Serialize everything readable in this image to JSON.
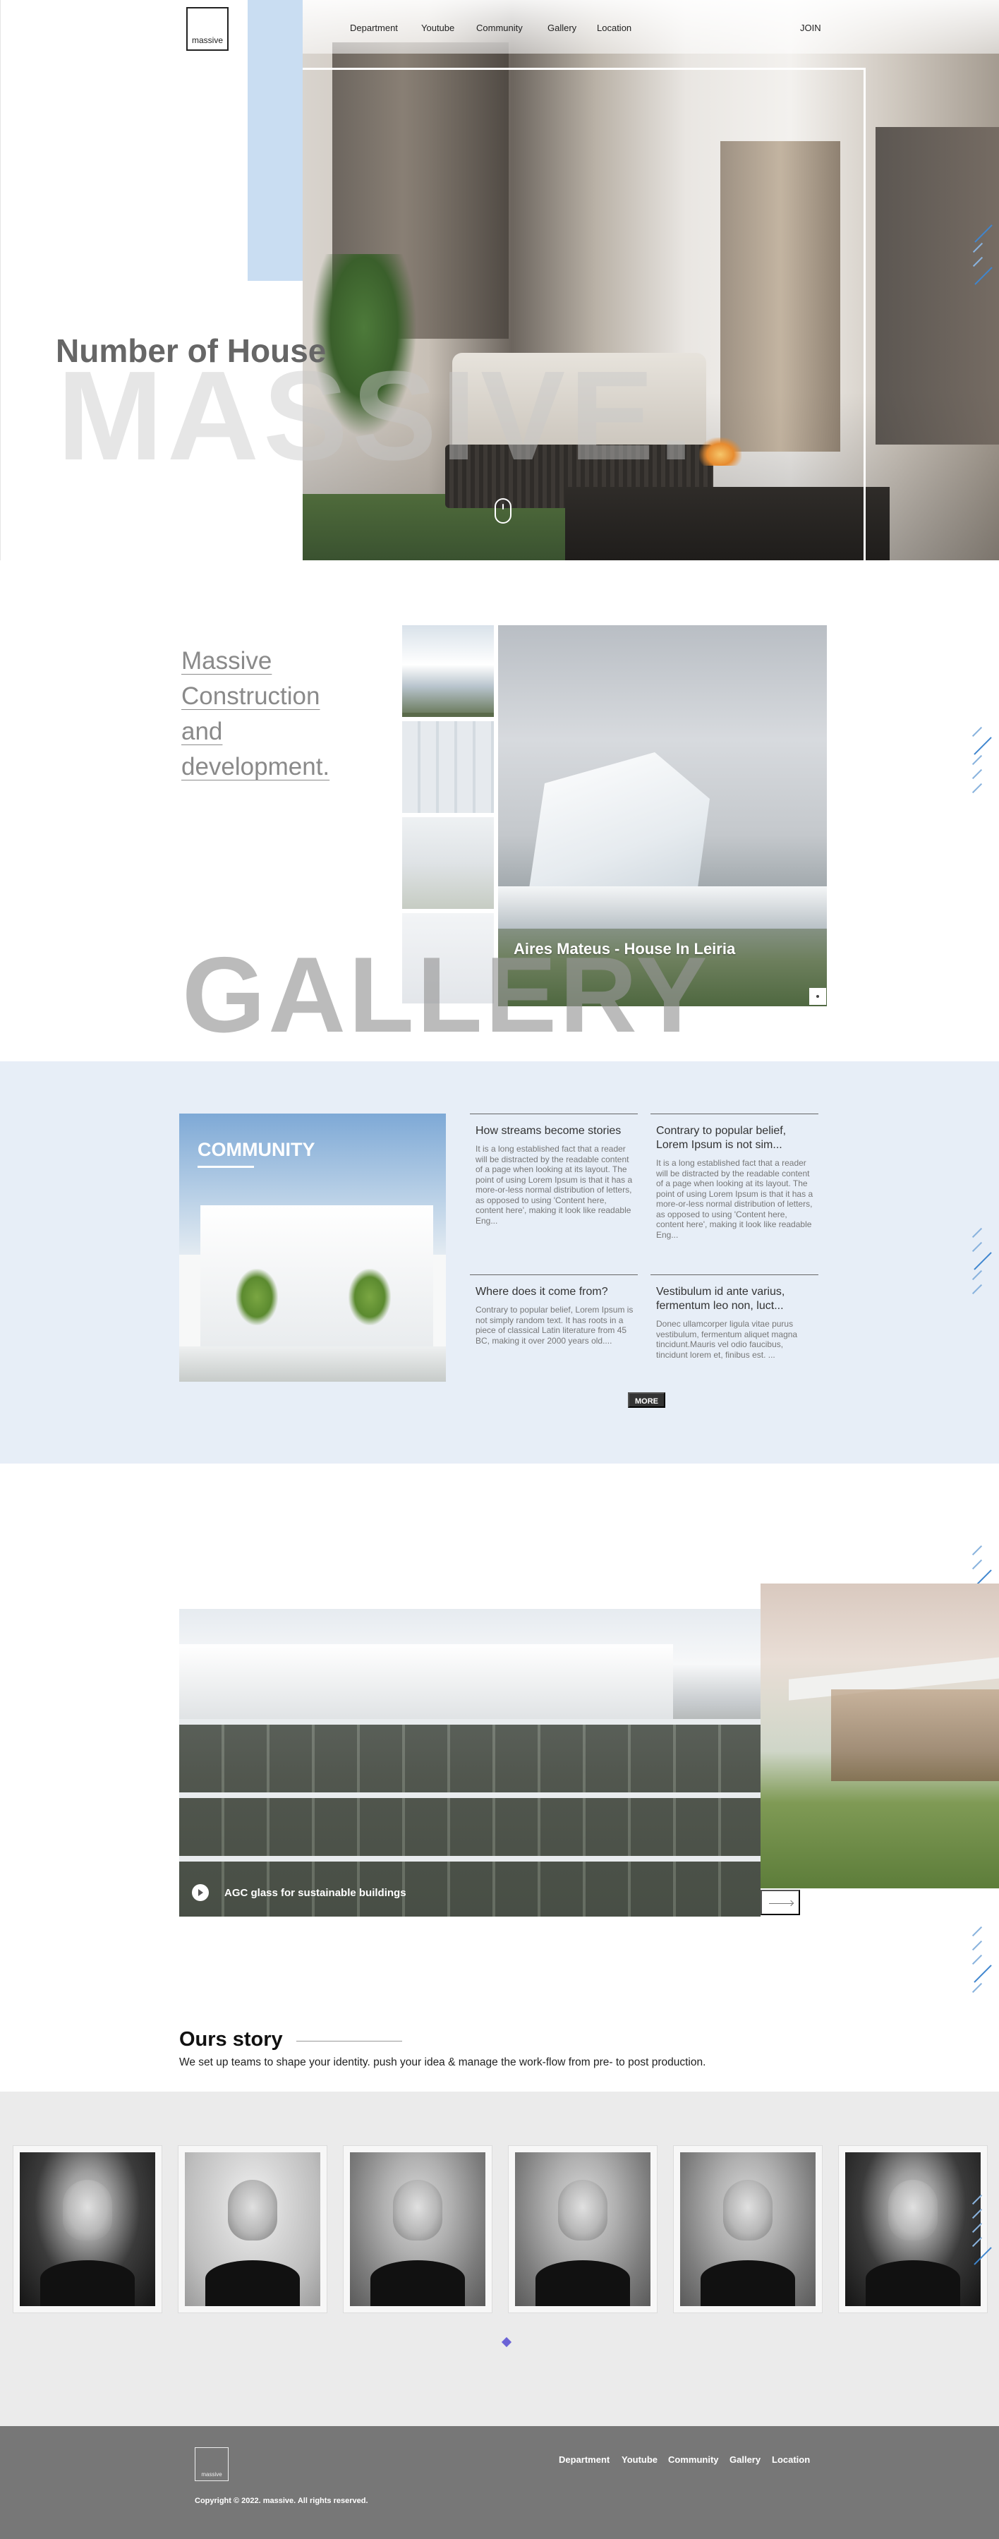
{
  "header": {
    "logo_text": "massive",
    "nav": [
      "Department",
      "Youtube",
      "Community",
      "Gallery",
      "Location"
    ],
    "join_label": "JOIN"
  },
  "hero": {
    "title": "Number of House",
    "big_word": "MASSIVE."
  },
  "gallery": {
    "heading": "Massive Construction and development.",
    "feature_caption": "Aires Mateus - House In Leiria",
    "big_word": "GALLERY"
  },
  "community": {
    "label": "COMMUNITY",
    "articles": [
      {
        "title": "How streams become stories",
        "text": "It is a long established fact that a reader will be distracted by the readable content of a page when looking at its layout. The point of using Lorem Ipsum is that it has a more-or-less normal distribution of letters, as opposed to using 'Content here, content here', making it look like readable Eng..."
      },
      {
        "title": "Contrary to popular belief, Lorem Ipsum is not sim...",
        "text": "It is a long established fact that a reader will be distracted by the readable content of a page when looking at its layout. The point of using Lorem Ipsum is that it has a more-or-less normal distribution of letters, as opposed to using 'Content here, content here', making it look like readable Eng..."
      },
      {
        "title": "Where does it come from?",
        "text": "Contrary to popular belief, Lorem Ipsum is not simply random text. It has roots in a piece of classical Latin literature from 45 BC, making it over 2000 years old...."
      },
      {
        "title": "Vestibulum id ante varius, fermentum leo non, luct...",
        "text": "Donec ullamcorper ligula vitae purus vestibulum, fermentum aliquet magna tincidunt.Mauris vel odio faucibus, tincidunt lorem et, finibus est. ..."
      }
    ],
    "more_label": "MORE"
  },
  "buildings": {
    "caption": "AGC glass for sustainable buildings"
  },
  "story": {
    "title": "Ours story",
    "text": "We set up teams to shape your identity. push your idea & manage the work-flow from pre- to post production."
  },
  "footer": {
    "logo_text": "massive",
    "nav": [
      "Department",
      "Youtube",
      "Community",
      "Gallery",
      "Location"
    ],
    "copyright": "Copyright © 2022. massive. All rights reserved."
  },
  "colors": {
    "accent_blue": "#3f86cf",
    "light_blue_panel": "#c9ddf2",
    "community_bg": "#e7eef7",
    "footer_bg": "#777777",
    "slider_indicator": "#6b63d6"
  }
}
